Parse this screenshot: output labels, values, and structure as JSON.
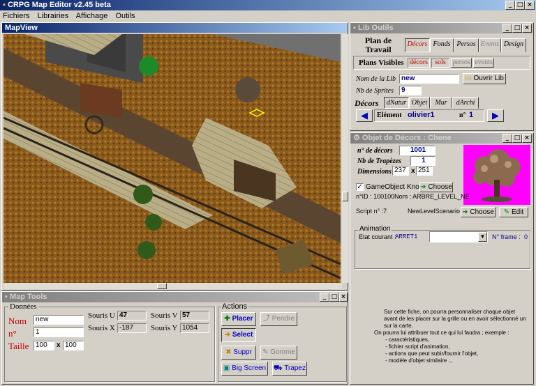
{
  "app": {
    "title": "CRPG Map Editor  v2.45 beta",
    "menu": [
      "Fichiers",
      "Librairies",
      "Affichage",
      "Outils"
    ]
  },
  "mapview": {
    "title": "MapView"
  },
  "lib": {
    "title": "Lib Outils",
    "plan": "Plan de Travail",
    "tabs": [
      "Décors",
      "Fonds",
      "Persos",
      "Events",
      "Design"
    ],
    "plans_label": "Plans Visibles",
    "plans": [
      "décors",
      "sols",
      "persos",
      "events"
    ],
    "nom_label": "Nom de la Lib",
    "nom_value": "new",
    "ouvrir": "Ouvrir Lib",
    "nb_label": "Nb de Sprites",
    "nb_value": "9",
    "decors_label": "Décors",
    "decor_tabs": [
      "dNatur",
      "Objet",
      "Mur",
      "dArchi"
    ],
    "element_label": "Elément",
    "element_value": "olivier1",
    "n_label": "n°",
    "n_value": "1"
  },
  "obj": {
    "title": "Objet de Décors : Chene",
    "ndecors_label": "n° de décors",
    "ndecors_value": "1001",
    "nbtrap_label": "Nb de Trapèzes",
    "nbtrap_value": "1",
    "dim_label": "Dimensions",
    "dim_w": "237",
    "dim_x": "x",
    "dim_h": "251",
    "go_label": "GameObject Known",
    "choose": "Choose",
    "nid": "n°ID : 100100Nom : ARBRE_LEVEL_NE",
    "script_label": "Script n° :7",
    "script_value": "NewLevelScenario",
    "edit": "Edit",
    "anim_label": "Animation",
    "etat_label": "Etat courant :",
    "etat_value": "ARRET1",
    "nframe_label": "N° frame :",
    "nframe_value": "0",
    "help": [
      "Sur cette fiche, on pourra personnaliser chaque objet avant de les placer sur la grille ou en avoir sélectionné un sur la carte.",
      "On pourra lui attribuer tout ce qui lui faudra ; exemple :",
      "- caractéristiques,",
      "- fichier script d'animation,",
      "- actions que peut subir/fournir l'objet,",
      "- modèle d'objet similaire ..."
    ]
  },
  "tools": {
    "title": "Map Tools",
    "donnees": "Données",
    "nom_label": "Nom",
    "nom_value": "new",
    "n_label": "n°",
    "n_value": "1",
    "taille_label": "Taille",
    "taille_w": "100",
    "taille_x": "x",
    "taille_h": "100",
    "su_label": "Souris U",
    "su_value": "47",
    "sv_label": "Souris V",
    "sv_value": "57",
    "sx_label": "Souris X",
    "sx_value": "-187",
    "sy_label": "Souris Y",
    "sy_value": "1054",
    "actions": "Actions",
    "placer": "Placer",
    "pendre": "Pendre",
    "select": "Select",
    "suppr": "Suppr",
    "gomme": "Gomme",
    "bigscreen": "Big Screen",
    "trapez": "Trapez"
  },
  "colors": {
    "title_active": "#0a246a",
    "title_fade": "#a6caf0",
    "label_red": "#c00000",
    "sprite_bg": "#ff00ff"
  }
}
